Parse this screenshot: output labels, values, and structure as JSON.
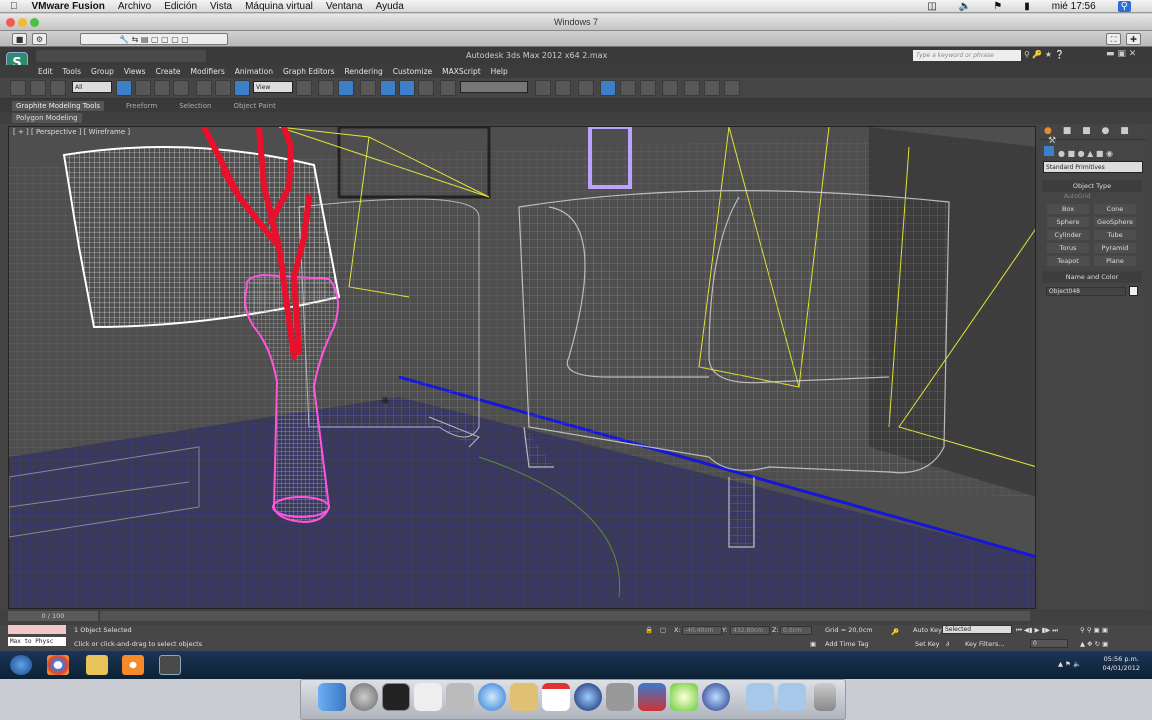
{
  "mac_menubar": {
    "app_name": "VMware Fusion",
    "items": [
      "Archivo",
      "Edición",
      "Vista",
      "Máquina virtual",
      "Ventana",
      "Ayuda"
    ],
    "clock": "mié 17:56"
  },
  "vm_window": {
    "title": "Windows 7"
  },
  "max": {
    "title": "Autodesk 3ds Max  2012 x64     2.max",
    "search_placeholder": "Type a keyword or phrase",
    "menu": [
      "Edit",
      "Tools",
      "Group",
      "Views",
      "Create",
      "Modifiers",
      "Animation",
      "Graph Editors",
      "Rendering",
      "Customize",
      "MAXScript",
      "Help"
    ],
    "selection_filter": "All",
    "ref_coord": "View",
    "ribbon_tabs": [
      "Graphite Modeling Tools",
      "Freeform",
      "Selection",
      "Object Paint"
    ],
    "ribbon_sub": "Polygon Modeling",
    "viewport_label": "[ + ] [ Perspective ] [ Wireframe ]",
    "command_panel": {
      "dropdown": "Standard Primitives",
      "object_type_header": "Object Type",
      "autogrid": "AutoGrid",
      "buttons": [
        "Box",
        "Cone",
        "Sphere",
        "GeoSphere",
        "Cylinder",
        "Tube",
        "Torus",
        "Pyramid",
        "Teapot",
        "Plane"
      ],
      "name_color_header": "Name and Color",
      "object_name": "Object048"
    },
    "time_slider": "0 / 100",
    "status": {
      "maxscript_line": "Max to Physc",
      "selected": "1 Object Selected",
      "prompt": "Click or click-and-drag to select objects",
      "x_label": "X:",
      "x_value": "-40,49cm",
      "y_label": "Y:",
      "y_value": "432,80cm",
      "z_label": "Z:",
      "z_value": "0,0cm",
      "grid": "Grid = 20,0cm",
      "add_time_tag": "Add Time Tag",
      "auto_key": "Auto Key",
      "set_key": "Set Key",
      "key_mode": "Selected",
      "key_filters": "Key Filters...",
      "frame": "0"
    }
  },
  "windows_taskbar": {
    "time": "05:56 p.m.",
    "date": "04/01/2012"
  },
  "colors": {
    "accent_blue": "#3e7fc9",
    "vase_pink": "#ff55dd",
    "branch_red": "#e8102a"
  }
}
